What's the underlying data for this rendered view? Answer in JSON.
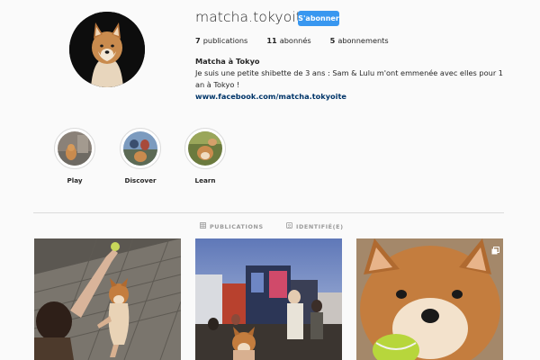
{
  "profile": {
    "username": "matcha.tokyoite",
    "follow_label": "S'abonner",
    "stats": [
      {
        "num": "7",
        "label": "publications"
      },
      {
        "num": "11",
        "label": "abonnés"
      },
      {
        "num": "5",
        "label": "abonnements"
      }
    ],
    "bio_name": "Matcha à Tokyo",
    "bio_text": "Je suis une petite shibette de 3 ans : Sam & Lulu m'ont emmenée avec elles pour 1 an à Tokyo !",
    "bio_link": "www.facebook.com/matcha.tokyoite"
  },
  "highlights": [
    {
      "label": "Play"
    },
    {
      "label": "Discover"
    },
    {
      "label": "Learn"
    }
  ],
  "tabs": [
    {
      "label": "PUBLICATIONS",
      "icon": "grid-icon"
    },
    {
      "label": "IDENTIFIÉ(E)",
      "icon": "tag-icon"
    }
  ],
  "posts": [
    {
      "icon": "photo"
    },
    {
      "icon": "photo"
    },
    {
      "icon": "multiple-photos-icon"
    }
  ],
  "colors": {
    "accent": "#3897f0",
    "link": "#003569",
    "background": "#fafafa",
    "border": "#dbdbdb"
  }
}
